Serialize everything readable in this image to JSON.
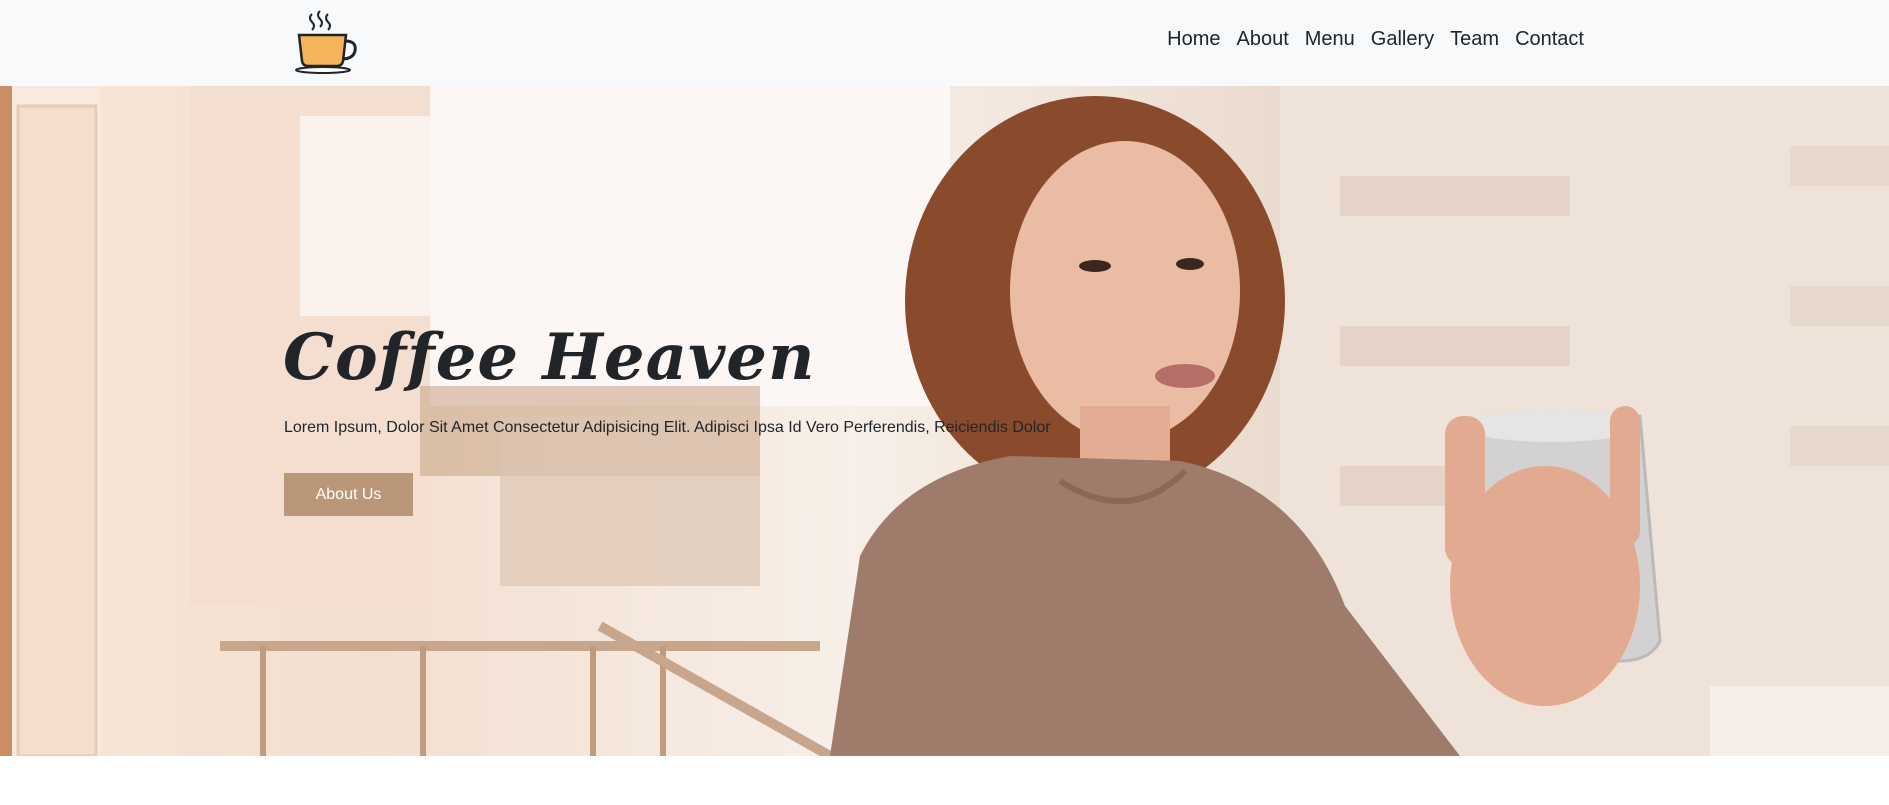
{
  "nav": {
    "logo_icon": "coffee-cup-icon",
    "links": [
      "Home",
      "About",
      "Menu",
      "Gallery",
      "Team",
      "Contact"
    ]
  },
  "hero": {
    "title": "Coffee Heaven",
    "text": "Lorem Ipsum, Dolor Sit Amet Consectetur Adipisicing Elit. Adipisci Ipsa Id Vero Perferendis, Reiciendis Dolor",
    "button_label": "About Us"
  },
  "colors": {
    "navbar_bg": "#f8f9fa",
    "button_bg": "#b99778",
    "text_dark": "#212529",
    "logo_cup": "#f5b45a"
  }
}
